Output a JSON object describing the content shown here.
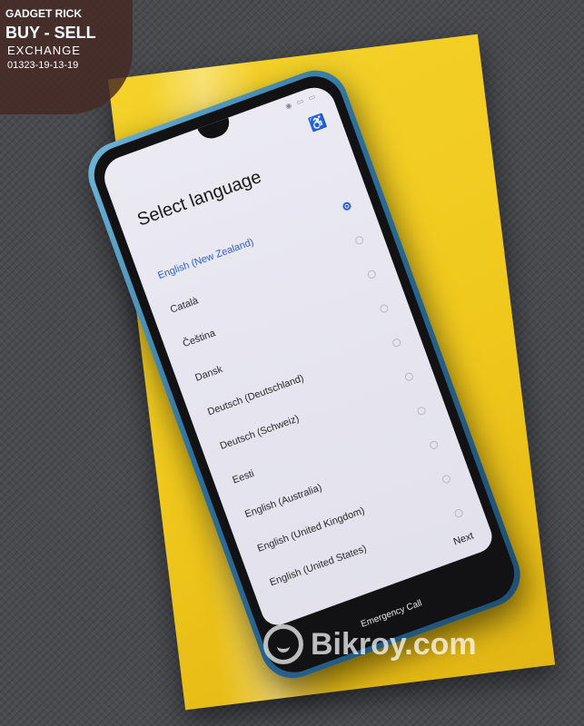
{
  "watermark": {
    "line1": "GADGET RICK",
    "line2": "BUY - SELL",
    "line3": "EXCHANGE",
    "line4": "01323-19-13-19",
    "site": "Bikroy.com"
  },
  "phone_screen": {
    "title": "Select language",
    "languages": [
      {
        "label": "English (New Zealand)",
        "selected": true
      },
      {
        "label": "Català",
        "selected": false
      },
      {
        "label": "Čeština",
        "selected": false
      },
      {
        "label": "Dansk",
        "selected": false
      },
      {
        "label": "Deutsch (Deutschland)",
        "selected": false
      },
      {
        "label": "Deutsch (Schweiz)",
        "selected": false
      },
      {
        "label": "Eesti",
        "selected": false
      },
      {
        "label": "English (Australia)",
        "selected": false
      },
      {
        "label": "English (United Kingdom)",
        "selected": false
      },
      {
        "label": "English (United States)",
        "selected": false
      }
    ],
    "next_label": "Next",
    "emergency_call_label": "Emergency Call",
    "accessibility_icon": "accessibility-icon",
    "accent_color": "#2f5fcf"
  },
  "colors": {
    "box_yellow": "#f0c81c",
    "phone_frame": "#2d6f9a",
    "badge_brown": "#46281f"
  }
}
